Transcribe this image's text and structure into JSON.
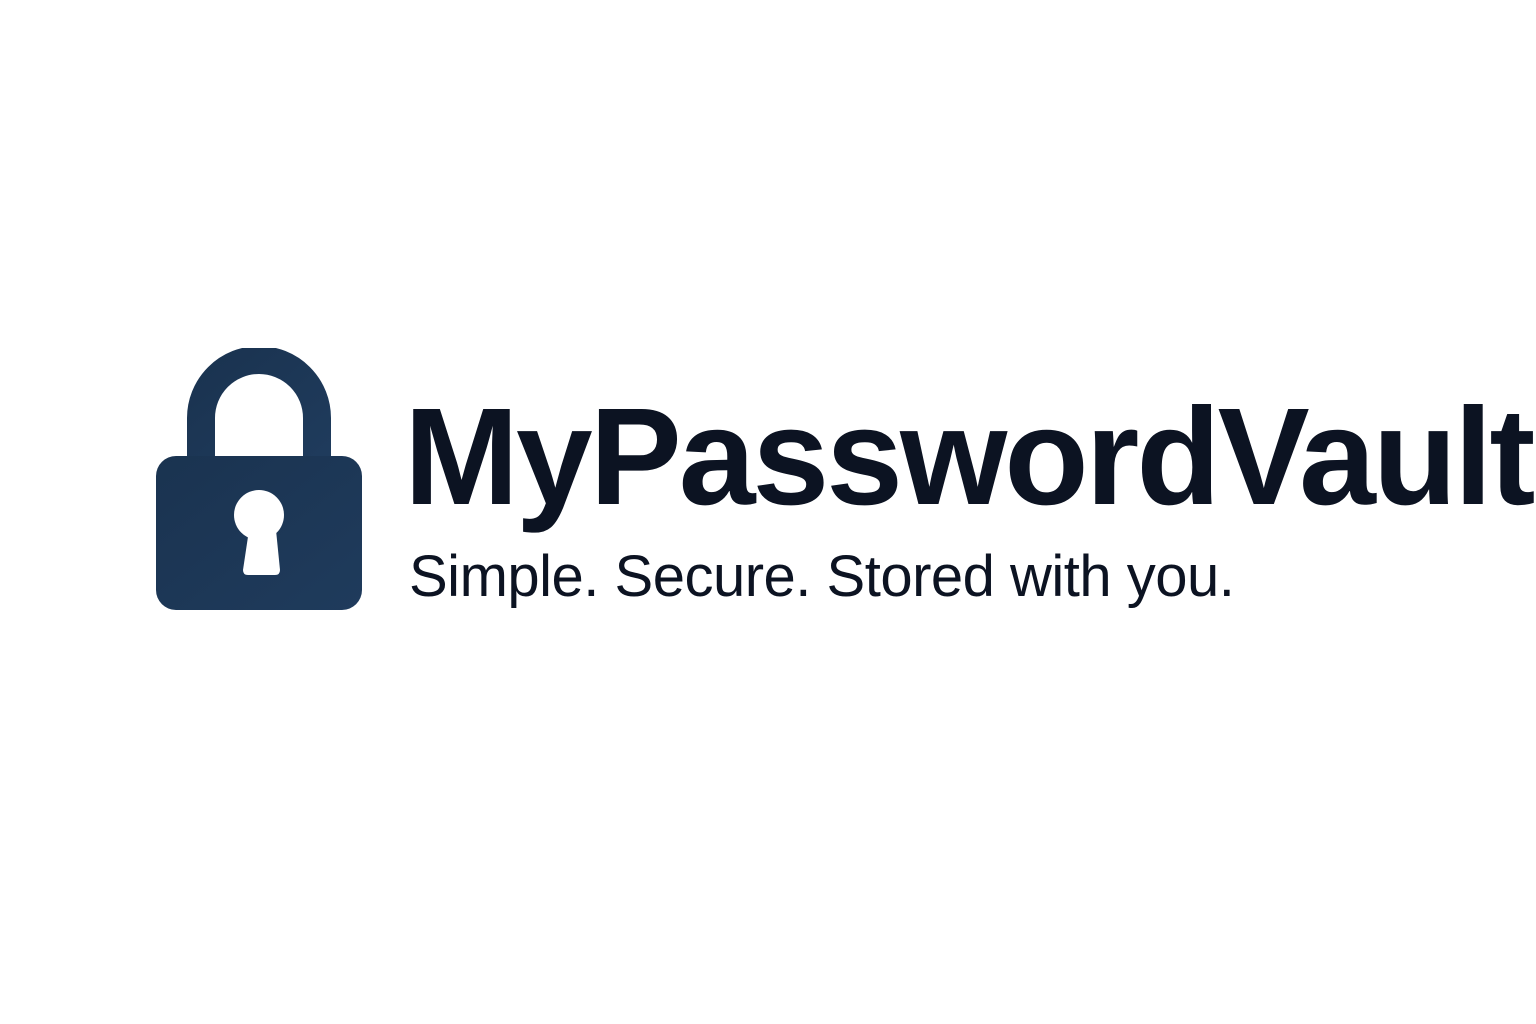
{
  "logo": {
    "icon": "padlock-keyhole-icon",
    "color": "#1c3654",
    "keyhole_color": "#ffffff"
  },
  "brand": {
    "name": "MyPasswordVault",
    "tagline": "Simple. Secure. Stored with you.",
    "text_color": "#0c1322"
  }
}
